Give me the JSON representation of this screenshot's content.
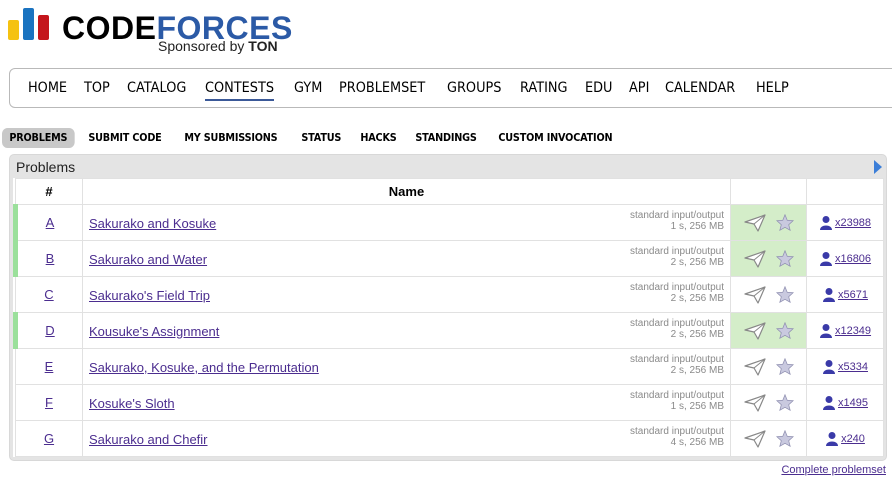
{
  "logo": {
    "word_part1": "CODE",
    "word_part2": "FORCES",
    "sponsor_text": "Sponsored by",
    "sponsor_brand": "TON"
  },
  "main_nav": [
    "HOME",
    "TOP",
    "CATALOG",
    "CONTESTS",
    "GYM",
    "PROBLEMSET",
    "GROUPS",
    "RATING",
    "EDU",
    "API",
    "CALENDAR",
    "HELP"
  ],
  "sub_nav": [
    "PROBLEMS",
    "SUBMIT CODE",
    "MY SUBMISSIONS",
    "STATUS",
    "HACKS",
    "STANDINGS",
    "CUSTOM INVOCATION"
  ],
  "panel": {
    "title": "Problems",
    "columns": {
      "index": "#",
      "name": "Name"
    },
    "rows": [
      {
        "id": "A",
        "name": "Sakurako and Kosuke",
        "io": "standard input/output",
        "limits": "1 s, 256 MB",
        "solved": "x23988",
        "accepted": true
      },
      {
        "id": "B",
        "name": "Sakurako and Water",
        "io": "standard input/output",
        "limits": "2 s, 256 MB",
        "solved": "x16806",
        "accepted": true
      },
      {
        "id": "C",
        "name": "Sakurako's Field Trip",
        "io": "standard input/output",
        "limits": "2 s, 256 MB",
        "solved": "x5671",
        "accepted": false
      },
      {
        "id": "D",
        "name": "Kousuke's Assignment",
        "io": "standard input/output",
        "limits": "2 s, 256 MB",
        "solved": "x12349",
        "accepted": true
      },
      {
        "id": "E",
        "name": "Sakurako, Kosuke, and the Permutation",
        "io": "standard input/output",
        "limits": "2 s, 256 MB",
        "solved": "x5334",
        "accepted": false
      },
      {
        "id": "F",
        "name": "Kosuke's Sloth",
        "io": "standard input/output",
        "limits": "1 s, 256 MB",
        "solved": "x1495",
        "accepted": false
      },
      {
        "id": "G",
        "name": "Sakurako and Chefir",
        "io": "standard input/output",
        "limits": "4 s, 256 MB",
        "solved": "x240",
        "accepted": false
      }
    ]
  },
  "footer_link": "Complete problemset",
  "colors": {
    "accent": "#3b5998",
    "link": "#4b2d8f",
    "accepted_bg": "#d4edc9",
    "accepted_mark": "#9be09b"
  },
  "icons": [
    "send-icon",
    "star-icon",
    "user-icon",
    "arrow-right-icon"
  ]
}
